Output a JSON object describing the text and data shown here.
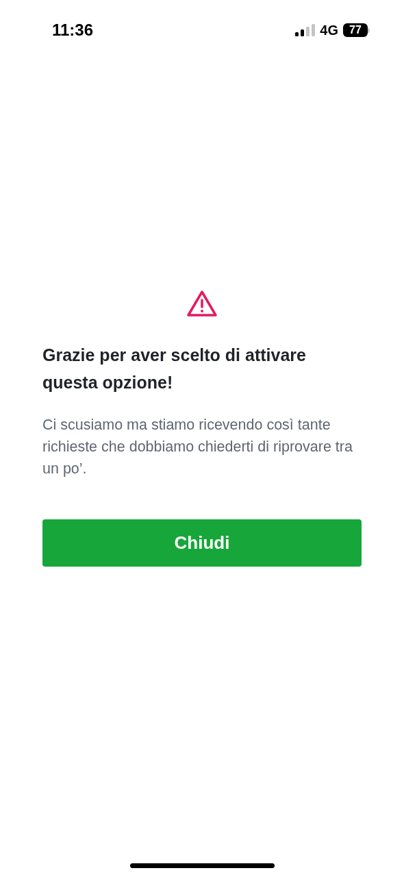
{
  "status_bar": {
    "time": "11:36",
    "network": "4G",
    "battery": "77"
  },
  "dialog": {
    "title": "Grazie per aver scelto di attivare questa opzione!",
    "message": "Ci scusiamo ma stiamo ricevendo così tante richieste che dobbiamo chiederti di riprovare tra un po’.",
    "button": "Chiudi"
  }
}
